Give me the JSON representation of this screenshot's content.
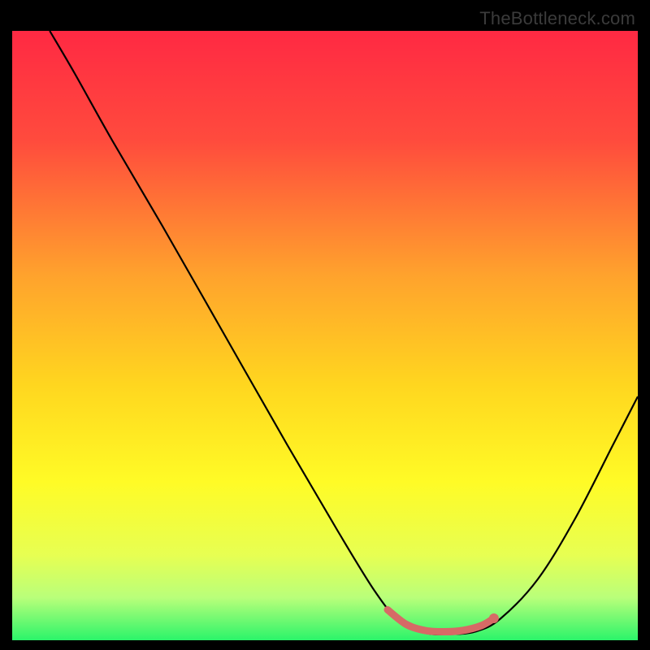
{
  "watermark": "TheBottleneck.com",
  "chart_data": {
    "type": "line",
    "title": "",
    "xlabel": "",
    "ylabel": "",
    "xlim": [
      0,
      100
    ],
    "ylim": [
      0,
      100
    ],
    "gradient_stops": [
      {
        "offset": 0,
        "color": "#ff2943"
      },
      {
        "offset": 18,
        "color": "#ff4b3d"
      },
      {
        "offset": 40,
        "color": "#ffa22d"
      },
      {
        "offset": 58,
        "color": "#ffd61f"
      },
      {
        "offset": 74,
        "color": "#fffb26"
      },
      {
        "offset": 86,
        "color": "#e7ff52"
      },
      {
        "offset": 93,
        "color": "#b9ff7a"
      },
      {
        "offset": 100,
        "color": "#2bf46a"
      }
    ],
    "curve": {
      "name": "bottleneck-curve",
      "color": "#000000",
      "width": 2.2,
      "points": [
        {
          "x": 6,
          "y": 100
        },
        {
          "x": 10,
          "y": 93
        },
        {
          "x": 16,
          "y": 82
        },
        {
          "x": 24,
          "y": 68
        },
        {
          "x": 34,
          "y": 50
        },
        {
          "x": 44,
          "y": 32
        },
        {
          "x": 52,
          "y": 18
        },
        {
          "x": 58,
          "y": 8
        },
        {
          "x": 62,
          "y": 3
        },
        {
          "x": 66,
          "y": 1.2
        },
        {
          "x": 70,
          "y": 1.0
        },
        {
          "x": 74,
          "y": 1.4
        },
        {
          "x": 78,
          "y": 3.5
        },
        {
          "x": 84,
          "y": 10
        },
        {
          "x": 90,
          "y": 20
        },
        {
          "x": 96,
          "y": 32
        },
        {
          "x": 100,
          "y": 40
        }
      ]
    },
    "highlight_band": {
      "name": "valley-band",
      "color": "#d66a66",
      "width": 9,
      "points": [
        {
          "x": 60,
          "y": 5.0
        },
        {
          "x": 63,
          "y": 2.6
        },
        {
          "x": 66,
          "y": 1.6
        },
        {
          "x": 69,
          "y": 1.4
        },
        {
          "x": 72,
          "y": 1.6
        },
        {
          "x": 75,
          "y": 2.4
        },
        {
          "x": 77,
          "y": 3.6
        }
      ]
    },
    "highlight_dot": {
      "name": "highlight-dot",
      "color": "#d66a66",
      "x": 77,
      "y": 3.6,
      "r": 6
    }
  }
}
